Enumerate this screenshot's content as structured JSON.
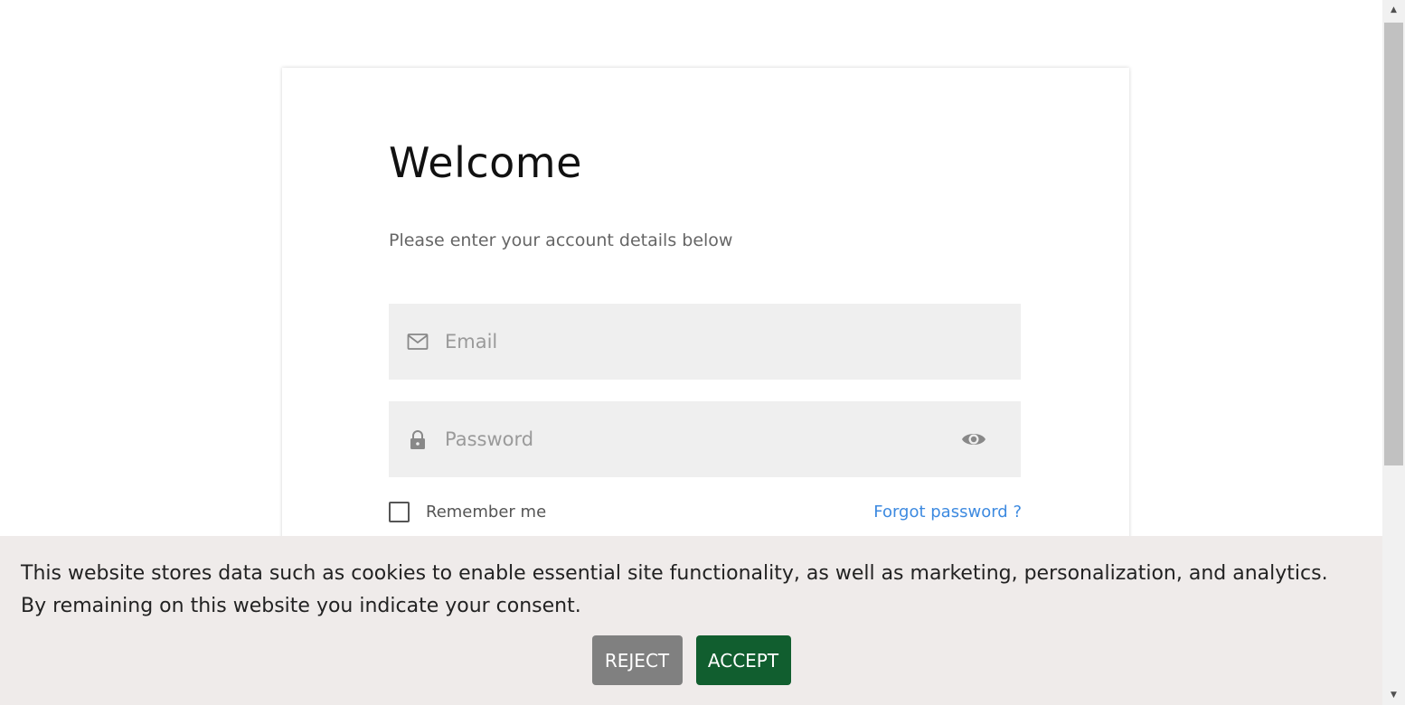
{
  "login": {
    "title": "Welcome",
    "subtitle": "Please enter your account details below",
    "email": {
      "placeholder": "Email",
      "value": "",
      "icon": "mail-icon"
    },
    "password": {
      "placeholder": "Password",
      "value": "",
      "icon": "lock-icon",
      "toggle_icon": "eye-icon"
    },
    "remember_label": "Remember me",
    "remember_checked": false,
    "forgot_label": "Forgot password ?"
  },
  "cookie_banner": {
    "text": "This website stores data such as cookies to enable essential site functionality, as well as marketing, personalization, and analytics. By remaining on this website you indicate your consent.",
    "reject_label": "REJECT",
    "accept_label": "ACCEPT"
  },
  "colors": {
    "accent_link": "#3d8ae0",
    "accept_button": "#115e2f",
    "reject_button": "#808080",
    "banner_background": "#efebea",
    "field_background": "#efefef"
  }
}
